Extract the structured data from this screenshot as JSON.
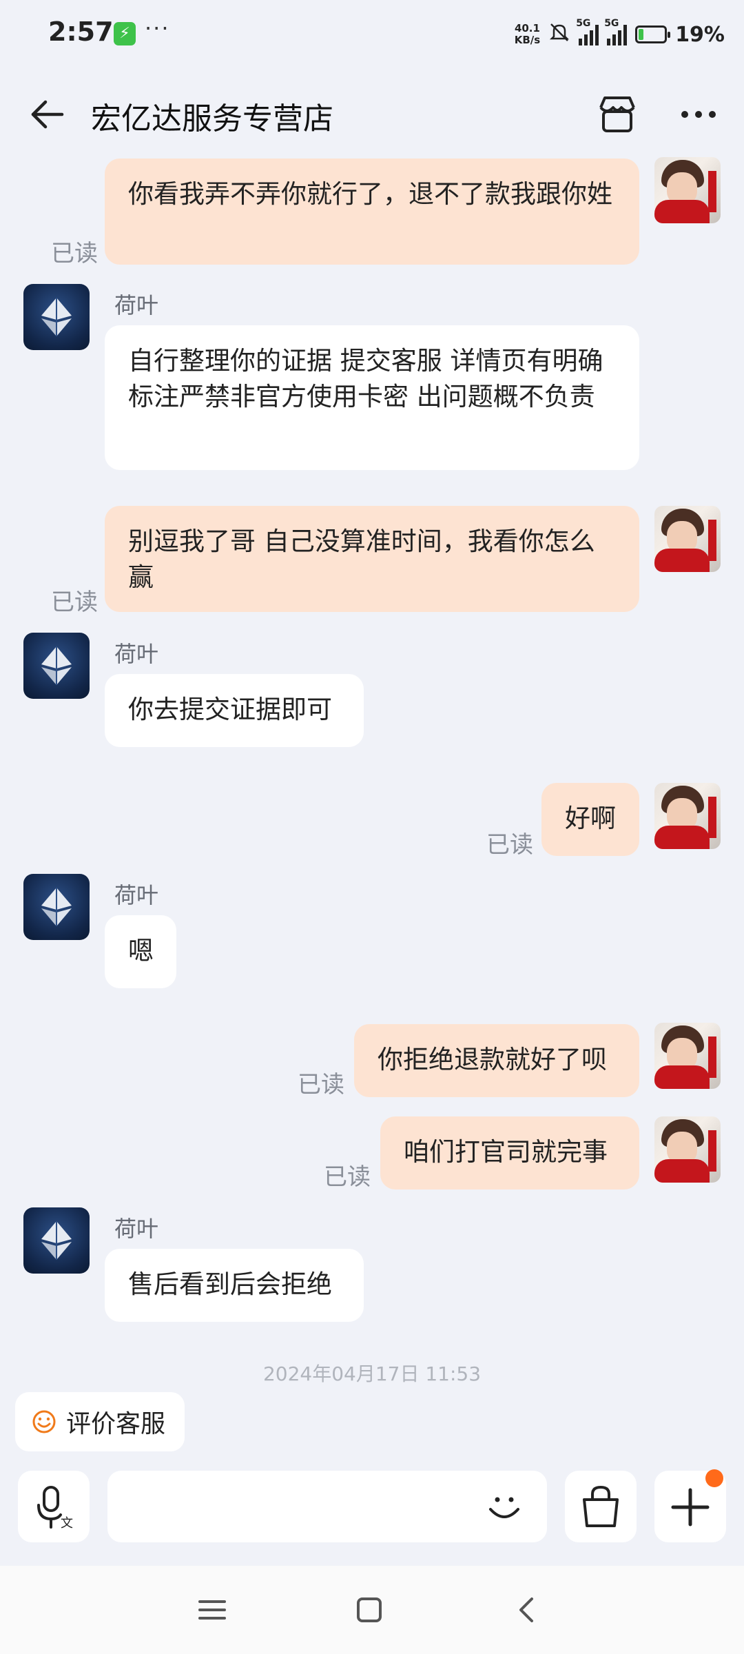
{
  "status_bar": {
    "time": "2:57",
    "more": "···",
    "net_speed_value": "40.1",
    "net_speed_unit": "KB/s",
    "signal1_label": "5G",
    "signal2_label": "5G",
    "battery_percent": "19%"
  },
  "header": {
    "title": "宏亿达服务专营店"
  },
  "messages": [
    {
      "side": "out",
      "text": "你看我弄不弄你就行了，退不了款我跟你姓",
      "status": "已读"
    },
    {
      "side": "in",
      "sender": "荷叶",
      "text": "自行整理你的证据 提交客服 详情页有明确标注严禁非官方使用卡密 出问题概不负责"
    },
    {
      "side": "out",
      "text": "别逗我了哥 自己没算准时间，我看你怎么赢",
      "status": "已读"
    },
    {
      "side": "in",
      "sender": "荷叶",
      "text": "你去提交证据即可"
    },
    {
      "side": "out",
      "text": "好啊",
      "status": "已读"
    },
    {
      "side": "in",
      "sender": "荷叶",
      "text": "嗯"
    },
    {
      "side": "out",
      "text": "你拒绝退款就好了呗",
      "status": "已读"
    },
    {
      "side": "out",
      "text": "咱们打官司就完事",
      "status": "已读"
    },
    {
      "side": "in",
      "sender": "荷叶",
      "text": "售后看到后会拒绝"
    }
  ],
  "timestamp": "2024年04月17日 11:53",
  "rate_chip": {
    "label": "评价客服"
  },
  "icons": {
    "back": "arrow-left-icon",
    "store": "store-icon",
    "more": "more-dots-icon",
    "voice": "voice-input-icon",
    "emoji": "emoji-icon",
    "shopping": "shopping-bag-icon",
    "plus": "plus-icon",
    "menu": "menu-icon",
    "home": "home-icon",
    "nav_back": "chevron-left-icon"
  },
  "colors": {
    "outgoing_bubble": "#fde3d2",
    "incoming_bubble": "#ffffff",
    "background": "#f0f2f8",
    "badge": "#ff6a1a"
  }
}
